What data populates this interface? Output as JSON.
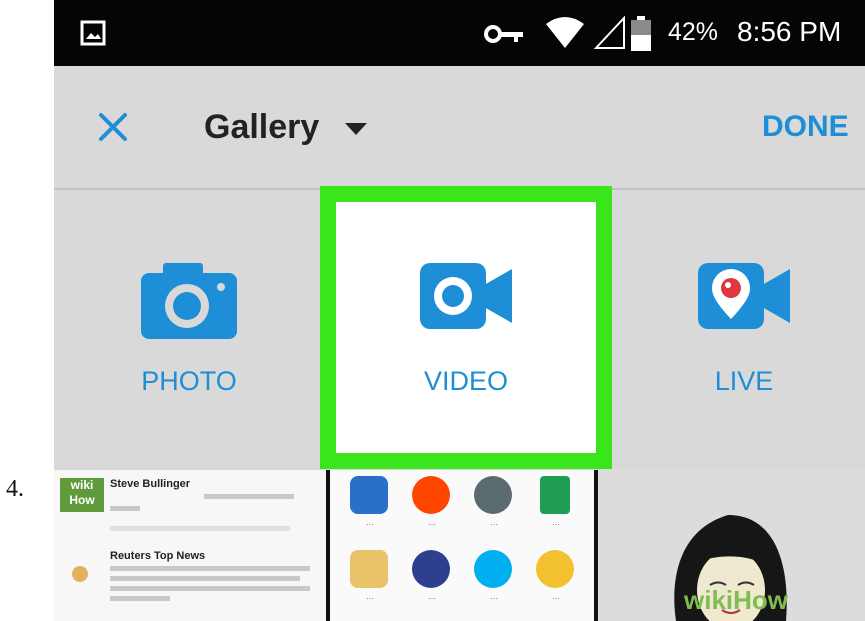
{
  "step_number": "4.",
  "status_bar": {
    "battery": "42%",
    "time": "8:56 PM"
  },
  "toolbar": {
    "title": "Gallery",
    "done_label": "DONE"
  },
  "modes": {
    "photo_label": "PHOTO",
    "video_label": "VIDEO",
    "live_label": "LIVE",
    "selected": "VIDEO",
    "highlight_color": "#39e61c"
  },
  "thumbnails": {
    "twitter_logo": "wiki How",
    "twitter_user_1": "Steve Bullinger",
    "twitter_user_2": "Reuters Top News"
  },
  "watermark": "wikiHow",
  "colors": {
    "accent": "#1e8ed6",
    "background": "#d9d9d9"
  },
  "icons": [
    "gallery-icon",
    "key-icon",
    "wifi-icon",
    "signal-icon",
    "battery-icon",
    "close-icon",
    "chevron-down-icon",
    "camera-icon",
    "video-camera-icon",
    "periscope-live-icon"
  ]
}
